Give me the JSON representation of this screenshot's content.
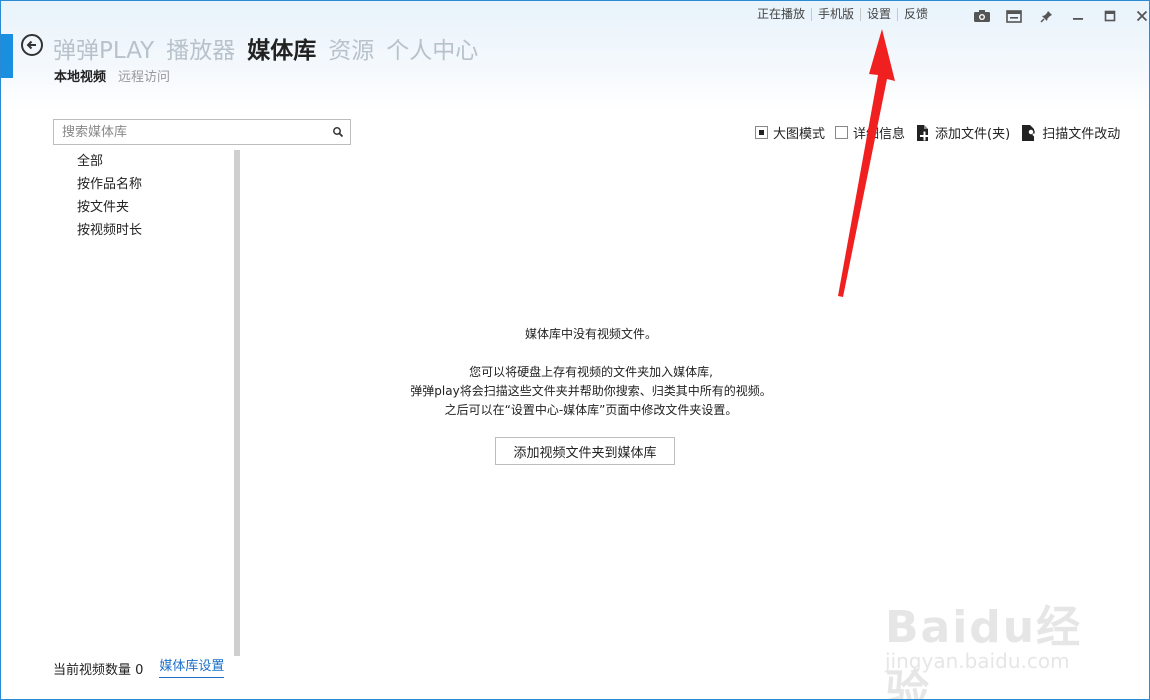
{
  "nav": {
    "main": [
      {
        "label": "弹弹PLAY",
        "active": false
      },
      {
        "label": "播放器",
        "active": false
      },
      {
        "label": "媒体库",
        "active": true
      },
      {
        "label": "资源",
        "active": false
      },
      {
        "label": "个人中心",
        "active": false
      }
    ],
    "sub": [
      {
        "label": "本地视频",
        "active": true
      },
      {
        "label": "远程访问",
        "active": false
      }
    ]
  },
  "top_links": [
    "正在播放",
    "手机版",
    "设置",
    "反馈"
  ],
  "window_controls": [
    "camera-icon",
    "mini-mode-icon",
    "pin-icon",
    "minimize-icon",
    "maximize-icon",
    "close-icon"
  ],
  "search": {
    "placeholder": "搜索媒体库",
    "value": ""
  },
  "side_list": [
    "全部",
    "按作品名称",
    "按文件夹",
    "按视频时长"
  ],
  "toolbar": {
    "large_mode": "大图模式",
    "detail_info": "详细信息",
    "add_folder": "添加文件(夹)",
    "scan_changes": "扫描文件改动"
  },
  "empty_state": {
    "title": "媒体库中没有视频文件。",
    "desc1": "您可以将硬盘上存有视频的文件夹加入媒体库,",
    "desc2": "弹弹play将会扫描这些文件夹并帮助你搜索、归类其中所有的视频。",
    "desc3": "之后可以在“设置中心-媒体库”页面中修改文件夹设置。",
    "button": "添加视频文件夹到媒体库"
  },
  "footer": {
    "count_label": "当前视频数量 0",
    "settings_link": "媒体库设置"
  },
  "watermark": {
    "logo": "Baidu经验",
    "url": "jingyan.baidu.com"
  },
  "colors": {
    "accent": "#1a8fe0",
    "link": "#1a6fc9",
    "annotation": "#f02020"
  }
}
